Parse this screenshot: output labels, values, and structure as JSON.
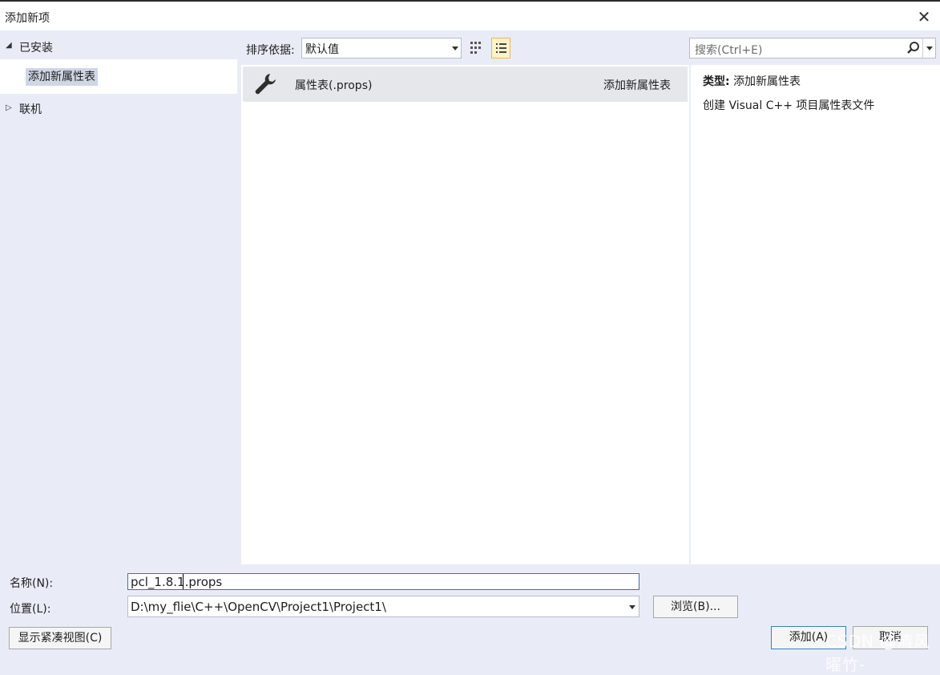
{
  "window": {
    "title": "添加新项",
    "close_symbol": "✕"
  },
  "tree": {
    "installed": {
      "label": "已安装",
      "arrow": "◢"
    },
    "selected_item": {
      "label": "添加新属性表"
    },
    "online": {
      "label": "联机",
      "arrow": "▷"
    }
  },
  "toolbar": {
    "sort_label": "排序依据:",
    "sort_value": "默认值",
    "view_modes": [
      "grid-view-icon",
      "list-view-icon"
    ],
    "active_view": "list-view-icon"
  },
  "search": {
    "placeholder": "搜索(Ctrl+E)"
  },
  "items": [
    {
      "icon": "wrench-icon",
      "name": "属性表(.props)",
      "category": "添加新属性表"
    }
  ],
  "details": {
    "type_label": "类型:",
    "type_value": "添加新属性表",
    "description": "创建 Visual C++ 项目属性表文件"
  },
  "form": {
    "name_label": "名称(N):",
    "name_value": "pcl_1.8.1.props",
    "location_label": "位置(L):",
    "location_value": "D:\\my_flie\\C++\\OpenCV\\Project1\\Project1\\",
    "browse_label": "浏览(B)...",
    "compact_view_label": "显示紧凑视图(C)",
    "add_label": "添加(A)",
    "cancel_label": "取消"
  },
  "watermark": "CSDN @清风曜竹-",
  "colors": {
    "background": "#e9ecf6",
    "pane": "#ffffff",
    "selected_row": "#e6e7ea",
    "tree_selection": "#cfd6e5",
    "active_view_button": "#fff1c8",
    "focus_border": "#3d6fb3"
  }
}
